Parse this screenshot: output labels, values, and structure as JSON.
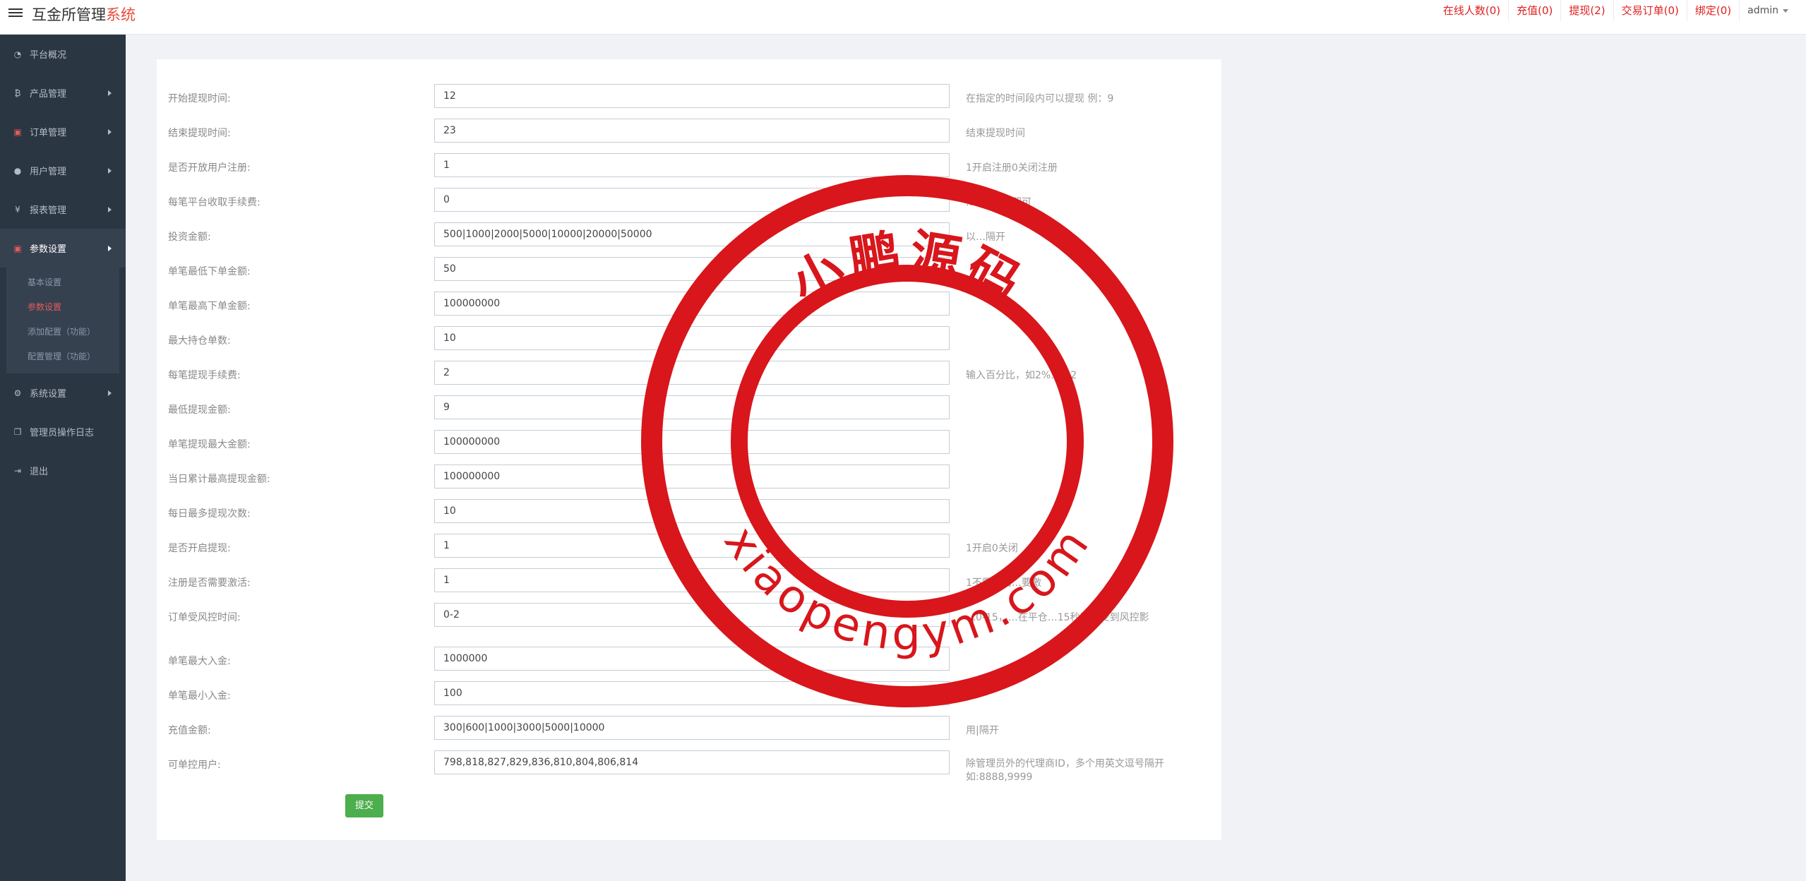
{
  "header": {
    "brand_main": "互金所管理",
    "brand_accent": "系统",
    "nav": [
      {
        "label": "在线人数(0)"
      },
      {
        "label": "充值(0)"
      },
      {
        "label": "提现(2)"
      },
      {
        "label": "交易订单(0)"
      },
      {
        "label": "绑定(0)"
      }
    ],
    "user": "admin"
  },
  "sidebar": {
    "items": [
      {
        "label": "平台概况",
        "icon": "dashboard-icon"
      },
      {
        "label": "产品管理",
        "icon": "bitcoin-icon"
      },
      {
        "label": "订单管理",
        "icon": "clipboard-icon"
      },
      {
        "label": "用户管理",
        "icon": "user-icon"
      },
      {
        "label": "报表管理",
        "icon": "yen-icon"
      },
      {
        "label": "参数设置",
        "icon": "clipboard-icon"
      },
      {
        "label": "系统设置",
        "icon": "gears-icon"
      },
      {
        "label": "管理员操作日志",
        "icon": "copy-icon"
      },
      {
        "label": "退出",
        "icon": "sign-out-icon"
      }
    ],
    "submenu": [
      {
        "label": "基本设置"
      },
      {
        "label": "参数设置"
      },
      {
        "label": "添加配置（功能）"
      },
      {
        "label": "配置管理（功能）"
      }
    ]
  },
  "form": {
    "rows": [
      {
        "label": "开始提现时间:",
        "value": "12",
        "hint": "在指定的时间段内可以提现 例：9"
      },
      {
        "label": "结束提现时间:",
        "value": "23",
        "hint": "结束提现时间"
      },
      {
        "label": "是否开放用户注册:",
        "value": "1",
        "hint": "1开启注册0关闭注册"
      },
      {
        "label": "每笔平台收取手续费:",
        "value": "0",
        "hint": "…就填写2即可"
      },
      {
        "label": "投资金额:",
        "value": "500|1000|2000|5000|10000|20000|50000",
        "hint": "以…隔开"
      },
      {
        "label": "单笔最低下单金额:",
        "value": "50",
        "hint": ""
      },
      {
        "label": "单笔最高下单金额:",
        "value": "100000000",
        "hint": ""
      },
      {
        "label": "最大持仓单数:",
        "value": "10",
        "hint": ""
      },
      {
        "label": "每笔提现手续费:",
        "value": "2",
        "hint": "输入百分比，如2%…入2"
      },
      {
        "label": "最低提现金额:",
        "value": "9",
        "hint": ""
      },
      {
        "label": "单笔提现最大金额:",
        "value": "100000000",
        "hint": ""
      },
      {
        "label": "当日累计最高提现金额:",
        "value": "100000000",
        "hint": ""
      },
      {
        "label": "每日最多提现次数:",
        "value": "10",
        "hint": ""
      },
      {
        "label": "是否开启提现:",
        "value": "1",
        "hint": "1开启0关闭"
      },
      {
        "label": "注册是否需要激活:",
        "value": "1",
        "hint": "1不需激活…要激"
      },
      {
        "label": "订单受风控时间:",
        "value": "0-2",
        "hint": "…0-15，…在平仓…15秒开始受到风控影"
      },
      {
        "label": "单笔最大入金:",
        "value": "1000000",
        "hint": ""
      },
      {
        "label": "单笔最小入金:",
        "value": "100",
        "hint": ""
      },
      {
        "label": "充值金额:",
        "value": "300|600|1000|3000|5000|10000",
        "hint": "用|隔开"
      },
      {
        "label": "可单控用户:",
        "value": "798,818,827,829,836,810,804,806,814",
        "hint": "除管理员外的代理商ID，多个用英文逗号隔开如:8888,9999"
      }
    ],
    "submit_label": "提交"
  },
  "watermark": {
    "top_text": "小鹏源码",
    "bottom_text": "xiaopengym.com",
    "color": "#d8161b"
  }
}
